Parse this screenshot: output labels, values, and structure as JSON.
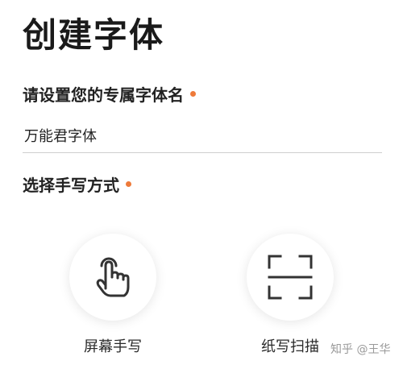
{
  "page": {
    "title": "创建字体"
  },
  "font_name": {
    "label": "请设置您的专属字体名",
    "value": "万能君字体"
  },
  "input_method": {
    "label": "选择手写方式",
    "options": [
      {
        "label": "屏幕手写",
        "icon": "hand-touch-icon"
      },
      {
        "label": "纸写扫描",
        "icon": "scan-frame-icon"
      }
    ]
  },
  "colors": {
    "required_dot": "#ee7a3a",
    "icon_stroke": "#333333"
  },
  "watermark": {
    "text": "知乎 @王华"
  }
}
